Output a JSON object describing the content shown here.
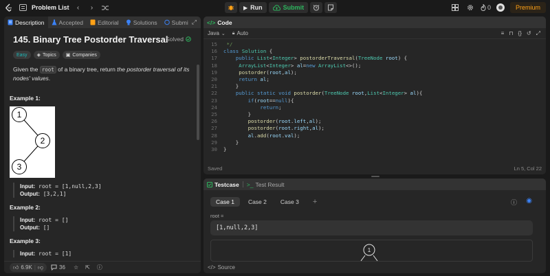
{
  "topbar": {
    "title": "Problem List",
    "run_label": "Run",
    "submit_label": "Submit",
    "streak": "0",
    "premium_label": "Premium"
  },
  "left_tabs": [
    {
      "label": "Description"
    },
    {
      "label": "Accepted"
    },
    {
      "label": "Editorial"
    },
    {
      "label": "Solutions"
    },
    {
      "label": "Submi"
    }
  ],
  "problem": {
    "title": "145. Binary Tree Postorder Traversal",
    "status": "Solved",
    "tags": [
      "Easy",
      "Topics",
      "Companies"
    ],
    "statement_prefix": "Given the ",
    "statement_code": "root",
    "statement_mid": " of a binary tree, return ",
    "statement_em": "the postorder traversal of its nodes' values",
    "statement_end": "."
  },
  "examples": [
    {
      "heading": "Example 1:",
      "input_label": "Input:",
      "input": "root = [1,null,2,3]",
      "output_label": "Output:",
      "output": "[3,2,1]",
      "tree_nodes": [
        "1",
        "2",
        "3"
      ]
    },
    {
      "heading": "Example 2:",
      "input_label": "Input:",
      "input": "root = []",
      "output_label": "Output:",
      "output": "[]"
    },
    {
      "heading": "Example 3:",
      "input_label": "Input:",
      "input": "root = [1]"
    }
  ],
  "footer": {
    "likes": "6.9K",
    "comments": "36"
  },
  "code_panel": {
    "title": "Code",
    "language": "Java",
    "mode": "Auto",
    "saved": "Saved",
    "cursor": "Ln 5, Col 22"
  },
  "code_lines": [
    {
      "n": "15",
      "html": "<span class='cm'> */</span>"
    },
    {
      "n": "16",
      "html": "<span class='kw'>class</span> <span class='ty'>Solution</span> {"
    },
    {
      "n": "17",
      "html": "    <span class='kw'>public</span> <span class='ty'>List</span>&lt;<span class='ty'>Integer</span>&gt; <span class='fn'>postorderTraversal</span>(<span class='ty'>TreeNode</span> <span class='vr'>root</span>) {"
    },
    {
      "n": "18",
      "html": "     <span class='ty'>ArrayList</span>&lt;<span class='ty'>Integer</span>&gt; <span class='vr'>al</span>=<span class='kw'>new</span> <span class='ty'>ArrayList</span>&lt;&gt;();"
    },
    {
      "n": "19",
      "html": "     <span class='fn'>postorder</span>(<span class='vr'>root</span>,<span class='vr'>al</span>);"
    },
    {
      "n": "20",
      "html": "     <span class='kw'>return</span> <span class='vr'>al</span>;"
    },
    {
      "n": "21",
      "html": "    }"
    },
    {
      "n": "22",
      "html": "    <span class='kw'>public</span> <span class='kw'>static</span> <span class='kw'>void</span> <span class='fn'>postorder</span>(<span class='ty'>TreeNode</span> <span class='vr'>root</span>,<span class='ty'>List</span>&lt;<span class='ty'>Integer</span>&gt; <span class='vr'>al</span>){"
    },
    {
      "n": "23",
      "html": "        <span class='kw'>if</span>(<span class='vr'>root</span>==<span class='kw'>null</span>){"
    },
    {
      "n": "24",
      "html": "            <span class='kw'>return</span>;"
    },
    {
      "n": "25",
      "html": "        }"
    },
    {
      "n": "26",
      "html": "        <span class='fn'>postorder</span>(<span class='vr'>root</span>.<span class='vr'>left</span>,<span class='vr'>al</span>);"
    },
    {
      "n": "27",
      "html": "        <span class='fn'>postorder</span>(<span class='vr'>root</span>.<span class='vr'>right</span>,<span class='vr'>al</span>);"
    },
    {
      "n": "28",
      "html": "        <span class='vr'>al</span>.<span class='fn'>add</span>(<span class='vr'>root</span>.<span class='vr'>val</span>);"
    },
    {
      "n": "29",
      "html": "    }"
    },
    {
      "n": "30",
      "html": "}"
    }
  ],
  "test_panel": {
    "tab_testcase": "Testcase",
    "tab_result": "Test Result",
    "cases": [
      "Case 1",
      "Case 2",
      "Case 3"
    ],
    "input_label": "root =",
    "input_value": "[1,null,2,3]",
    "preview_node": "1",
    "source_label": "Source"
  },
  "colors": {
    "accent": "#ffa116",
    "easy": "#1cbaba",
    "submit": "#2db55d",
    "solved": "#2db55d",
    "testcase": "#2db55d"
  }
}
